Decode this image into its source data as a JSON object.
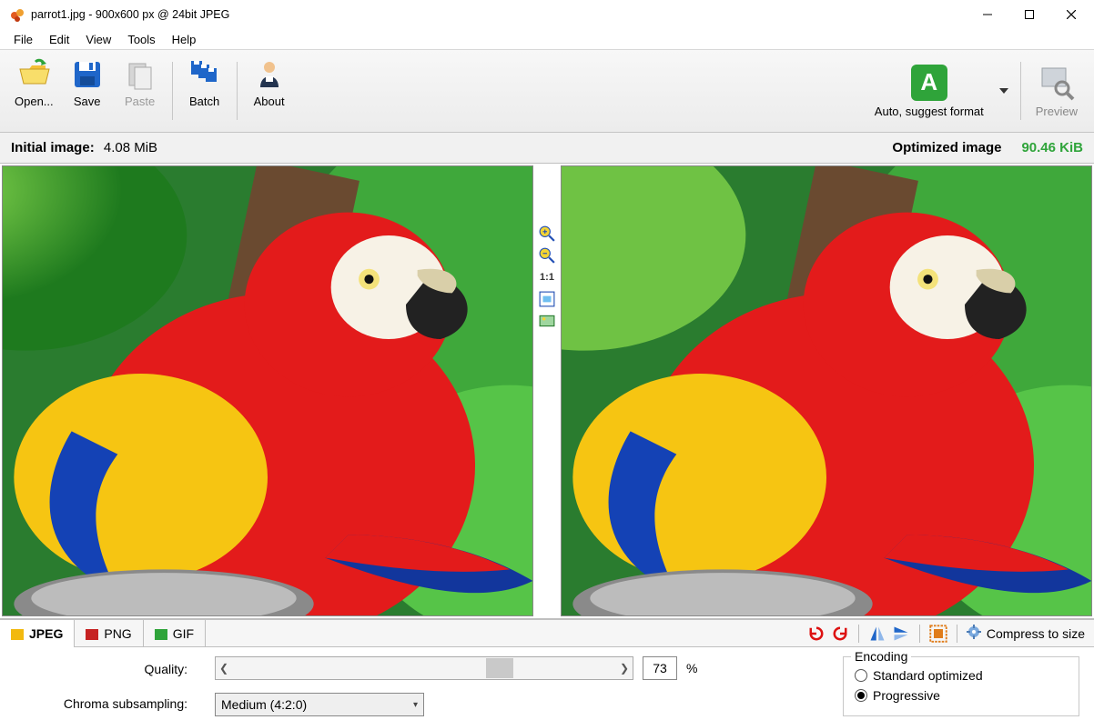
{
  "titlebar": {
    "text": "parrot1.jpg - 900x600 px @ 24bit JPEG"
  },
  "menu": [
    "File",
    "Edit",
    "View",
    "Tools",
    "Help"
  ],
  "toolbar": {
    "open": "Open...",
    "save": "Save",
    "paste": "Paste",
    "batch": "Batch",
    "about": "About",
    "auto": "Auto, suggest format",
    "auto_letter": "A",
    "preview": "Preview"
  },
  "info": {
    "initial_label": "Initial image:",
    "initial_size": "4.08 MiB",
    "optimized_label": "Optimized image",
    "optimized_size": "90.46 KiB"
  },
  "midstrip": {
    "fit_label": "1:1"
  },
  "tabs": {
    "jpeg": "JPEG",
    "png": "PNG",
    "gif": "GIF"
  },
  "tools": {
    "compress_label": "Compress to size"
  },
  "settings": {
    "quality_label": "Quality:",
    "quality_value": "73",
    "quality_pct": "%",
    "chroma_label": "Chroma subsampling:",
    "chroma_value": "Medium (4:2:0)",
    "encoding_label": "Encoding",
    "radio_standard": "Standard optimized",
    "radio_progressive": "Progressive"
  }
}
